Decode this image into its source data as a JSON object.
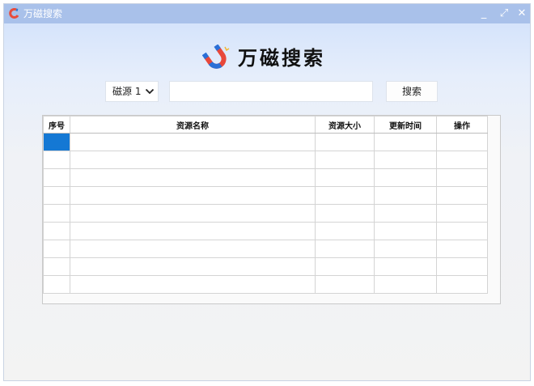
{
  "window": {
    "title": "万磁搜索",
    "controls": {
      "minimize": "_",
      "maximize": "⤢",
      "close": "✕"
    }
  },
  "logo": {
    "text": "万磁搜索",
    "icon": "magnet-icon"
  },
  "search": {
    "source_value": "磁源 1",
    "placeholder": "",
    "button_label": "搜索"
  },
  "table": {
    "headers": [
      "序号",
      "资源名称",
      "资源大小",
      "更新时间",
      "操作"
    ],
    "rows": [
      [
        "",
        "",
        "",
        "",
        ""
      ],
      [
        "",
        "",
        "",
        "",
        ""
      ],
      [
        "",
        "",
        "",
        "",
        ""
      ],
      [
        "",
        "",
        "",
        "",
        ""
      ],
      [
        "",
        "",
        "",
        "",
        ""
      ],
      [
        "",
        "",
        "",
        "",
        ""
      ],
      [
        "",
        "",
        "",
        "",
        ""
      ],
      [
        "",
        "",
        "",
        "",
        ""
      ],
      [
        "",
        "",
        "",
        "",
        ""
      ]
    ],
    "selected_color": "#1478d4"
  },
  "colors": {
    "titlebar": "#a9c1ea",
    "selection": "#1478d4"
  }
}
